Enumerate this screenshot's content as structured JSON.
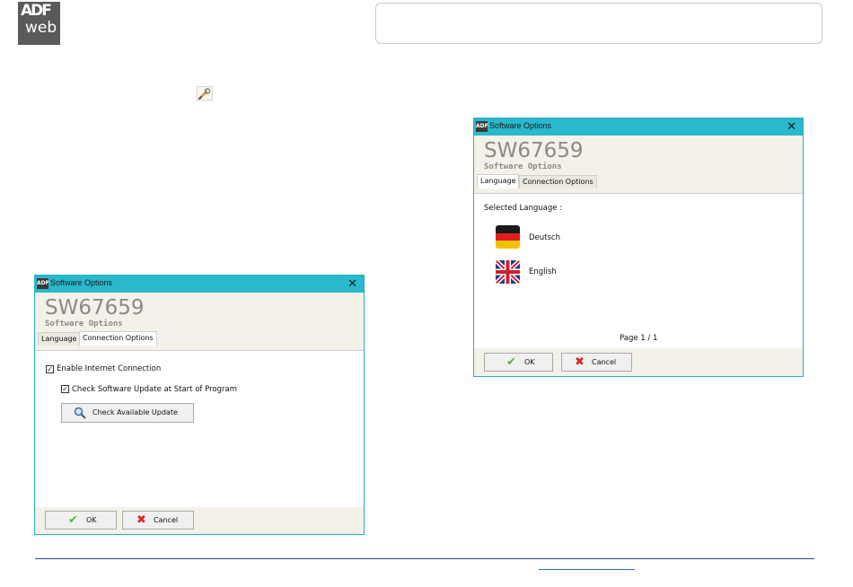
{
  "logo": {
    "line1": "ADF",
    "line2": "web"
  },
  "header_box": "",
  "dialog_right": {
    "title": "Software Options",
    "close": "✕",
    "product": "SW67659",
    "subtitle": "Software Options",
    "tabs": [
      "Language",
      "Connection Options"
    ],
    "selected_language_label": "Selected Language :",
    "languages": [
      "Deutsch",
      "English"
    ],
    "page": "Page 1 / 1",
    "ok_label": "OK",
    "cancel_label": "Cancel"
  },
  "dialog_left": {
    "title": "Software Options",
    "close": "✕",
    "product": "SW67659",
    "subtitle": "Software Options",
    "tabs": [
      "Language",
      "Connection Options"
    ],
    "enable_internet": "Enable Internet Connection",
    "check_update_start": "Check Software Update at Start of Program",
    "check_update_button": "Check Available Update",
    "ok_label": "OK",
    "cancel_label": "Cancel"
  },
  "colors": {
    "titlebar": "#2ab8cc",
    "dialog_bg": "#f4f1e8",
    "ok": "#5cb335",
    "cancel": "#d8291f"
  },
  "icons": [
    "wrench-icon",
    "ok-check-icon",
    "cancel-x-icon",
    "magnifier-icon",
    "flag-germany-icon",
    "flag-uk-icon"
  ]
}
